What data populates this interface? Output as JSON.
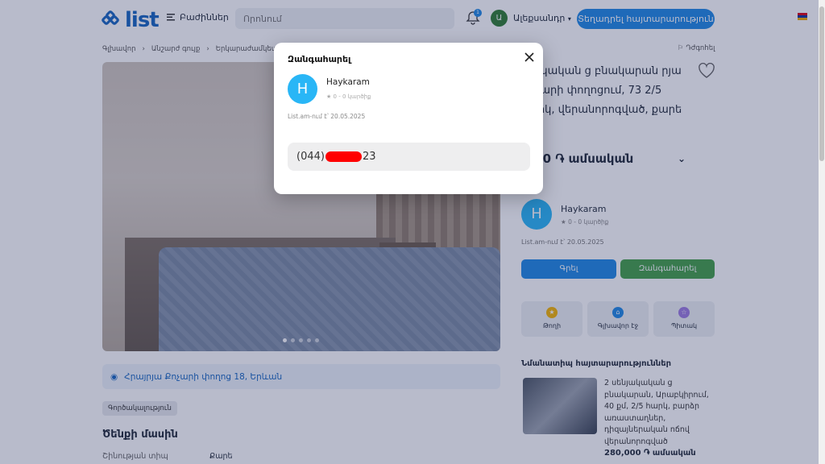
{
  "header": {
    "logo_text": "list",
    "categories_label": "Բաժիններ",
    "search_placeholder": "Որոնում",
    "notification_count": "1",
    "user_initial": "Ա",
    "user_name": "Ալեքսանդր",
    "post_button": "Տեղադրել հայտարարություն"
  },
  "breadcrumb": [
    "Գլխավոր",
    "Անշարժ գույք",
    "Երկարաժամկետ"
  ],
  "report_label": "Դժգոհել",
  "address": "Հրայրյա Քոչարի փողոց 18, Երևան",
  "tag": "Գործակալություն",
  "about": {
    "title": "Ծենքի մասին",
    "key": "Շինության տիպ",
    "value": "Քարե"
  },
  "listing": {
    "title": "նյակական ց բնակարան րյա Քոչարի փողոցում, 73 2/5 հարկ, վերանորոգված, քարե",
    "price": ",000 ֏ ամսական"
  },
  "seller": {
    "initial": "H",
    "name": "Haykaram",
    "rating": "0 - 0 կարծիք",
    "since": "List.am-ում է՝ 20.05.2025"
  },
  "buttons": {
    "write": "Գրել",
    "call": "Զանգահարել"
  },
  "actions": [
    {
      "label": "Թողի",
      "color": "#f5b400"
    },
    {
      "label": "Գլխավոր էջ",
      "color": "#1e88e5"
    },
    {
      "label": "Պիտակ",
      "color": "#9c7be0"
    }
  ],
  "similar": {
    "title": "Նմանատիպ հայտարարություններ",
    "item_text": "2 սենյակական ց բնակարան, Արաբկիրում, 40 քմ, 2/5 հարկ, բարձր առաստաղներ, դիզայներական ոճով վերանորոգված",
    "item_price": "280,000 ֏ ամսական"
  },
  "modal": {
    "title": "Զանգահարել",
    "seller_initial": "H",
    "seller_name": "Haykaram",
    "rating": "0 - 0 կարծիք",
    "since": "List.am-ում է՝ 20.05.2025",
    "phone_prefix": "(044)",
    "phone_suffix": "23"
  },
  "colors": {
    "brand": "#1565c0",
    "primary": "#1e88e5",
    "success": "#43a047",
    "avatar": "#29b6f6",
    "redaction": "#ff0000"
  }
}
